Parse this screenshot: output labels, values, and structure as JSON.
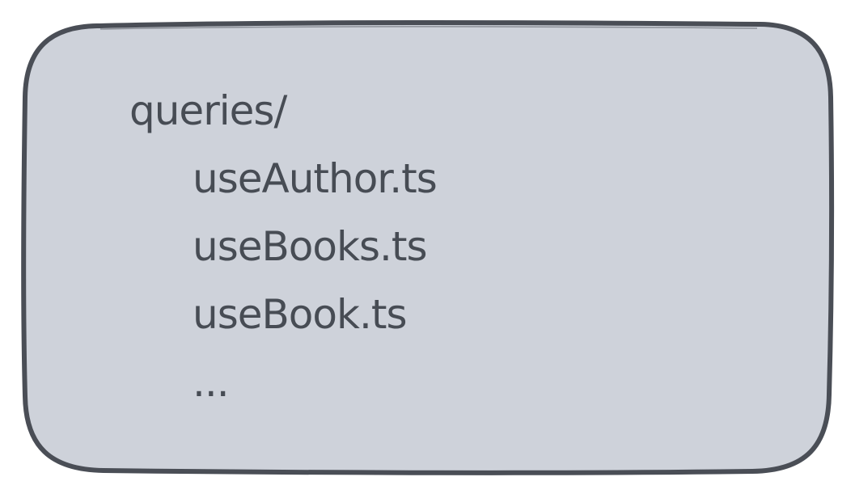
{
  "colors": {
    "card_fill": "#ced2da",
    "card_stroke": "#4a4e56",
    "text": "#474c54"
  },
  "tree": {
    "folder": "queries/",
    "files": [
      "useAuthor.ts",
      "useBooks.ts",
      "useBook.ts",
      "..."
    ]
  }
}
